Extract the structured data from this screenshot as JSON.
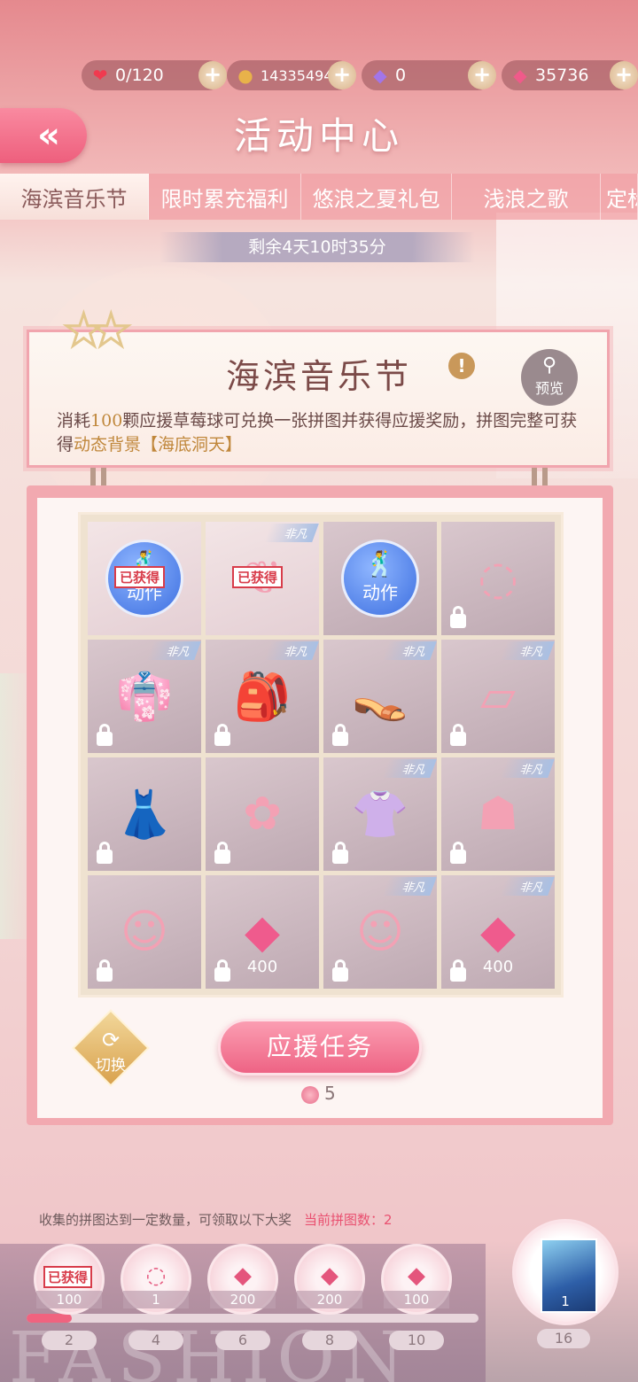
{
  "resources": {
    "stamina": "0/120",
    "gold": "14335494",
    "diamond": "0",
    "crystal": "35736"
  },
  "header": {
    "title": "活动中心",
    "back_icon": "double-chevron-left"
  },
  "tabs": [
    {
      "label": "海滨音乐节",
      "active": true
    },
    {
      "label": "限时累充福利",
      "active": false
    },
    {
      "label": "悠浪之夏礼包",
      "active": false
    },
    {
      "label": "浅浪之歌",
      "active": false
    },
    {
      "label": "定标",
      "active": false
    }
  ],
  "countdown": "剩余4天10时35分",
  "event": {
    "title": "海滨音乐节",
    "preview_label": "预览",
    "desc_prefix": "消耗",
    "desc_num": "100",
    "desc_mid": "颗应援草莓球可兑换一张拼图并获得应援奖励，拼图完整可获得",
    "desc_hl": "动态背景【海底洞天】"
  },
  "grid": {
    "obtained_label": "已获得",
    "action_label": "动作",
    "rare_label": "非凡",
    "cells": [
      {
        "item": "action",
        "obtained": true,
        "rare": false,
        "locked": false
      },
      {
        "item": "necklace",
        "obtained": true,
        "rare": true,
        "locked": false
      },
      {
        "item": "action",
        "obtained": false,
        "rare": false,
        "locked": false
      },
      {
        "item": "bracelet",
        "obtained": false,
        "rare": false,
        "locked": true
      },
      {
        "item": "jacket",
        "obtained": false,
        "rare": true,
        "locked": true
      },
      {
        "item": "backpack",
        "obtained": false,
        "rare": true,
        "locked": true
      },
      {
        "item": "shoes",
        "obtained": false,
        "rare": true,
        "locked": true
      },
      {
        "item": "socks",
        "obtained": false,
        "rare": true,
        "locked": true
      },
      {
        "item": "skirt",
        "obtained": false,
        "rare": false,
        "locked": true
      },
      {
        "item": "hair-clip",
        "obtained": false,
        "rare": false,
        "locked": true
      },
      {
        "item": "top",
        "obtained": false,
        "rare": true,
        "locked": true
      },
      {
        "item": "hair",
        "obtained": false,
        "rare": true,
        "locked": true
      },
      {
        "item": "portrait-card",
        "obtained": false,
        "rare": false,
        "locked": true
      },
      {
        "item": "diamond",
        "obtained": false,
        "rare": false,
        "locked": true,
        "amount": "400"
      },
      {
        "item": "portrait-badge",
        "obtained": false,
        "rare": true,
        "locked": true
      },
      {
        "item": "diamond",
        "obtained": false,
        "rare": true,
        "locked": true,
        "amount": "400"
      }
    ]
  },
  "switch_label": "切换",
  "task": {
    "label": "应援任务",
    "cost": "5"
  },
  "rewards": {
    "hint": "收集的拼图达到一定数量，可领取以下大奖",
    "current": "当前拼图数：2",
    "progress": 0.1,
    "items": [
      {
        "icon": "obtained",
        "count": "100",
        "tick": "2",
        "badge": "已获得"
      },
      {
        "icon": "ring",
        "count": "1",
        "tick": "4"
      },
      {
        "icon": "diamond",
        "count": "200",
        "tick": "6"
      },
      {
        "icon": "diamond",
        "count": "200",
        "tick": "8"
      },
      {
        "icon": "diamond",
        "count": "100",
        "tick": "10"
      }
    ],
    "grand": {
      "count": "1",
      "tick": "16"
    }
  },
  "watermark": "FASHION",
  "colors": {
    "accent": "#ee6384",
    "rare_tag": "#a9c0e4",
    "badge": "#d83c4a"
  }
}
